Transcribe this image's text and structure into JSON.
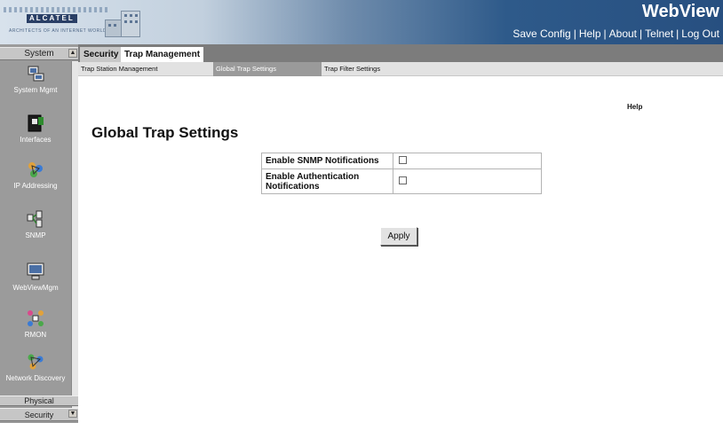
{
  "header": {
    "brand": "ALCATEL",
    "brand_tagline": "ARCHITECTS OF AN INTERNET WORLD",
    "title": "WebView",
    "links": [
      "Save Config",
      "Help",
      "About",
      "Telnet",
      "Log Out"
    ],
    "link_separator": "|"
  },
  "sidebar": {
    "top_label": "System",
    "items": [
      {
        "label": "System Mgmt",
        "icon": "system-mgmt-icon"
      },
      {
        "label": "Interfaces",
        "icon": "interfaces-icon"
      },
      {
        "label": "IP Addressing",
        "icon": "ip-addressing-icon"
      },
      {
        "label": "SNMP",
        "icon": "snmp-icon"
      },
      {
        "label": "WebViewMgm",
        "icon": "webview-mgmt-icon"
      },
      {
        "label": "RMON",
        "icon": "rmon-icon"
      },
      {
        "label": "Network Discovery",
        "icon": "network-discovery-icon"
      }
    ],
    "bottom_items": [
      "Physical",
      "Security"
    ]
  },
  "tabs": [
    {
      "label": "Security"
    },
    {
      "label": "Trap Management",
      "active": true
    }
  ],
  "subtabs": [
    {
      "label": "Trap Station Management"
    },
    {
      "label": "Global Trap Settings",
      "active": true
    },
    {
      "label": "Trap Filter Settings"
    }
  ],
  "content": {
    "help_label": "Help",
    "title": "Global Trap Settings",
    "settings": [
      {
        "label": "Enable SNMP Notifications",
        "checked": false
      },
      {
        "label": "Enable Authentication Notifications",
        "checked": false
      }
    ],
    "apply_label": "Apply"
  },
  "colors": {
    "header_dark": "#274f80",
    "sidebar_bg": "#9b9b9b",
    "tabbar_bg": "#7c7c7c"
  }
}
